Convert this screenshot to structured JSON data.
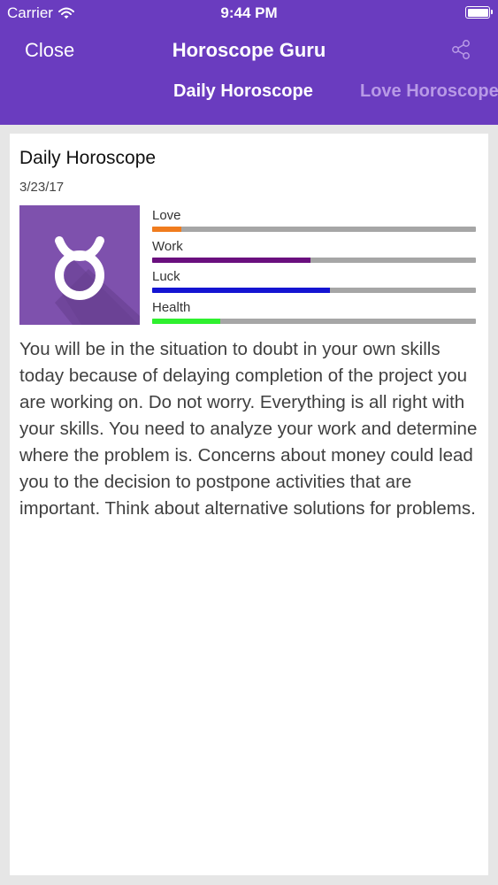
{
  "status_bar": {
    "carrier": "Carrier",
    "time": "9:44 PM"
  },
  "nav": {
    "close_label": "Close",
    "title": "Horoscope Guru"
  },
  "tabs": [
    {
      "label": "Daily Horoscope",
      "active": true
    },
    {
      "label": "Love Horoscope",
      "active": false
    }
  ],
  "card": {
    "title": "Daily Horoscope",
    "date": "3/23/17",
    "sign_icon": "taurus-icon",
    "ratings": [
      {
        "label": "Love",
        "fraction": 0.09,
        "color": "#f07c1e"
      },
      {
        "label": "Work",
        "fraction": 0.49,
        "color": "#6a0f7e"
      },
      {
        "label": "Luck",
        "fraction": 0.55,
        "color": "#1414d2"
      },
      {
        "label": "Health",
        "fraction": 0.21,
        "color": "#2ff02f"
      }
    ],
    "text": "You will be in the situation to doubt in your own skills today because of delaying completion of the project you are working on. Do not worry. Everything is all right with your skills. You need to analyze your work and determine where the problem is. Concerns about money could lead you to the decision to postpone activities that are important. Think about alternative solutions for problems."
  },
  "colors": {
    "header": "#6a3cbf",
    "sign_background": "#7e51ad"
  }
}
